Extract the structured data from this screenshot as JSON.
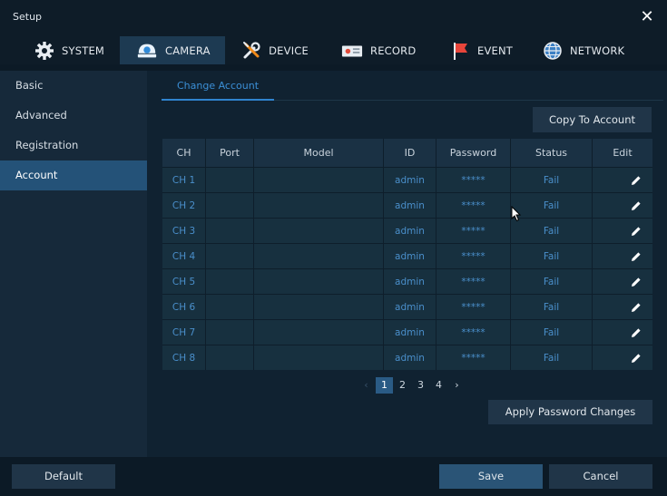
{
  "window": {
    "title": "Setup",
    "close_glyph": "✕"
  },
  "tabs": [
    {
      "label": "SYSTEM",
      "icon": "gear-icon",
      "active": false
    },
    {
      "label": "CAMERA",
      "icon": "camera-icon",
      "active": true
    },
    {
      "label": "DEVICE",
      "icon": "tools-icon",
      "active": false
    },
    {
      "label": "RECORD",
      "icon": "record-icon",
      "active": false
    },
    {
      "label": "EVENT",
      "icon": "flag-icon",
      "active": false
    },
    {
      "label": "NETWORK",
      "icon": "globe-icon",
      "active": false
    }
  ],
  "sidebar": {
    "items": [
      {
        "label": "Basic",
        "active": false
      },
      {
        "label": "Advanced",
        "active": false
      },
      {
        "label": "Registration",
        "active": false
      },
      {
        "label": "Account",
        "active": true
      }
    ]
  },
  "main": {
    "subtab": "Change Account",
    "copy_button": "Copy To Account",
    "apply_button": "Apply Password Changes",
    "table": {
      "headers": [
        "CH",
        "Port",
        "Model",
        "ID",
        "Password",
        "Status",
        "Edit"
      ],
      "rows": [
        {
          "ch": "CH 1",
          "port": "",
          "model": "",
          "id": "admin",
          "password": "*****",
          "status": "Fail"
        },
        {
          "ch": "CH 2",
          "port": "",
          "model": "",
          "id": "admin",
          "password": "*****",
          "status": "Fail"
        },
        {
          "ch": "CH 3",
          "port": "",
          "model": "",
          "id": "admin",
          "password": "*****",
          "status": "Fail"
        },
        {
          "ch": "CH 4",
          "port": "",
          "model": "",
          "id": "admin",
          "password": "*****",
          "status": "Fail"
        },
        {
          "ch": "CH 5",
          "port": "",
          "model": "",
          "id": "admin",
          "password": "*****",
          "status": "Fail"
        },
        {
          "ch": "CH 6",
          "port": "",
          "model": "",
          "id": "admin",
          "password": "*****",
          "status": "Fail"
        },
        {
          "ch": "CH 7",
          "port": "",
          "model": "",
          "id": "admin",
          "password": "*****",
          "status": "Fail"
        },
        {
          "ch": "CH 8",
          "port": "",
          "model": "",
          "id": "admin",
          "password": "*****",
          "status": "Fail"
        }
      ]
    },
    "pager": {
      "prev": "‹",
      "pages": [
        "1",
        "2",
        "3",
        "4"
      ],
      "current": "1",
      "next": "›"
    }
  },
  "footer": {
    "default": "Default",
    "save": "Save",
    "cancel": "Cancel"
  },
  "colors": {
    "accent": "#2f84cf",
    "active_sidebar": "#245278",
    "active_tab": "#1d3a52"
  }
}
